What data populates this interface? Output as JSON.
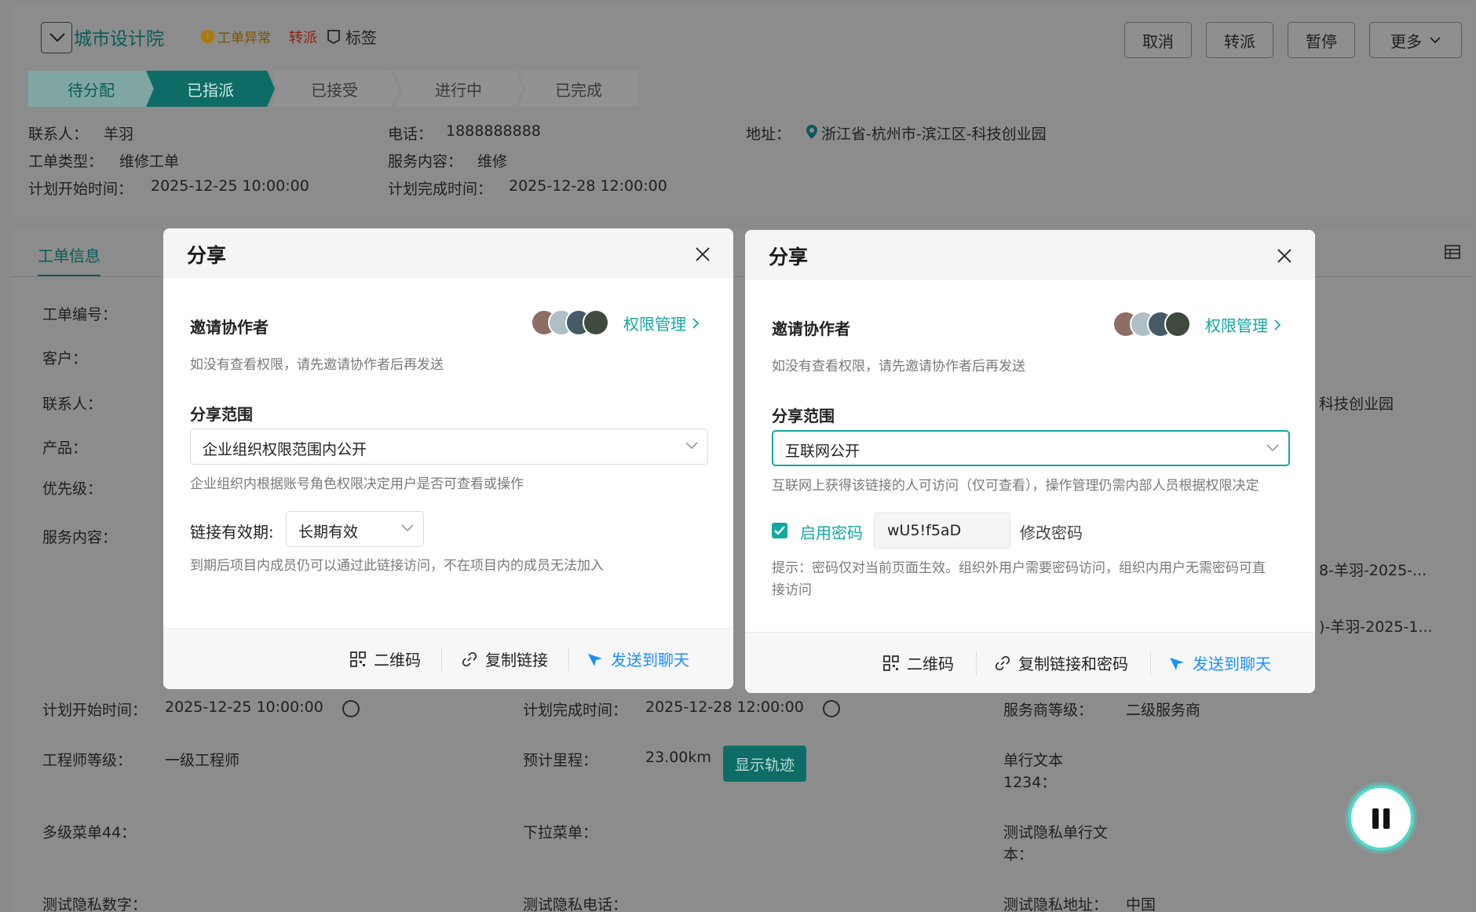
{
  "header": {
    "org_name": "城市设计院",
    "badge_abnormal": "工单异常",
    "badge_transfer": "转派",
    "tag_label": "标签",
    "buttons": {
      "cancel": "取消",
      "transfer": "转派",
      "pause": "暂停",
      "more": "更多"
    }
  },
  "steps": [
    "待分配",
    "已指派",
    "已接受",
    "进行中",
    "已完成"
  ],
  "summary": {
    "contact_label": "联系人：",
    "contact_value": "羊羽",
    "phone_label": "电话：",
    "phone_value": "1888888888",
    "address_label": "地址：",
    "address_value": "浙江省-杭州市-滨江区-科技创业园",
    "type_label": "工单类型：",
    "type_value": "维修工单",
    "service_label": "服务内容：",
    "service_value": "维修",
    "plan_start_label": "计划开始时间：",
    "plan_start_value": "2025-12-25 10:00:00",
    "plan_end_label": "计划完成时间：",
    "plan_end_value": "2025-12-28 12:00:00"
  },
  "main": {
    "tab_label": "工单信息",
    "left_labels": [
      "工单编号：",
      "客户：",
      "联系人：",
      "产品：",
      "优先级：",
      "服务内容："
    ],
    "right_fragments": {
      "address_tail": "科技创业园",
      "row1_tail": "8-羊羽-2025-...",
      "row2_tail": ")-羊羽-2025-1..."
    },
    "plan_start_label": "计划开始时间：",
    "plan_start_value": "2025-12-25 10:00:00",
    "plan_end_label": "计划完成时间：",
    "plan_end_value": "2025-12-28 12:00:00",
    "provider_level_label": "服务商等级：",
    "provider_level_value": "二级服务商",
    "engineer_level_label": "工程师等级：",
    "engineer_level_value": "一级工程师",
    "mileage_label": "预计里程：",
    "mileage_value": "23.00km",
    "show_track_button": "显示轨迹",
    "single_text_label": "单行文本",
    "single_text_label2": "1234：",
    "multilevel_label": "多级菜单44：",
    "dropdown_label": "下拉菜单：",
    "privacy_single_label": "测试隐私单行文",
    "privacy_single_label2": "本：",
    "privacy_number_label": "测试隐私数字：",
    "privacy_phone_label": "测试隐私电话：",
    "privacy_address_label": "测试隐私地址：",
    "privacy_address_value": "中国"
  },
  "dialog_left": {
    "title": "分享",
    "invite_title": "邀请协作者",
    "perm_link": "权限管理",
    "invite_hint": "如没有查看权限，请先邀请协作者后再发送",
    "scope_title": "分享范围",
    "scope_value": "企业组织权限范围内公开",
    "scope_hint": "企业组织内根据账号角色权限决定用户是否可查看或操作",
    "validity_label": "链接有效期:",
    "validity_value": "长期有效",
    "validity_hint": "到期后项目内成员仍可以通过此链接访问，不在项目内的成员无法加入",
    "footer": {
      "qrcode": "二维码",
      "copy": "复制链接",
      "send": "发送到聊天"
    }
  },
  "dialog_right": {
    "title": "分享",
    "invite_title": "邀请协作者",
    "perm_link": "权限管理",
    "invite_hint": "如没有查看权限，请先邀请协作者后再发送",
    "scope_title": "分享范围",
    "scope_value": "互联网公开",
    "scope_hint": "互联网上获得该链接的人可访问（仅可查看），操作管理仍需内部人员根据权限决定",
    "password_enable": "启用密码",
    "password_value": "wU5!f5aD",
    "password_change": "修改密码",
    "password_hint_line1": "提示：密码仅对当前页面生效。组织外用户需要密码访问，组织内用户无需密码可直",
    "password_hint_line2": "接访问",
    "footer": {
      "qrcode": "二维码",
      "copy": "复制链接和密码",
      "send": "发送到聊天"
    }
  },
  "colors": {
    "accent": "#13a8a0",
    "link_blue": "#1890ff",
    "abnormal_orange": "#c98a00",
    "transfer_red": "#c0392b"
  }
}
